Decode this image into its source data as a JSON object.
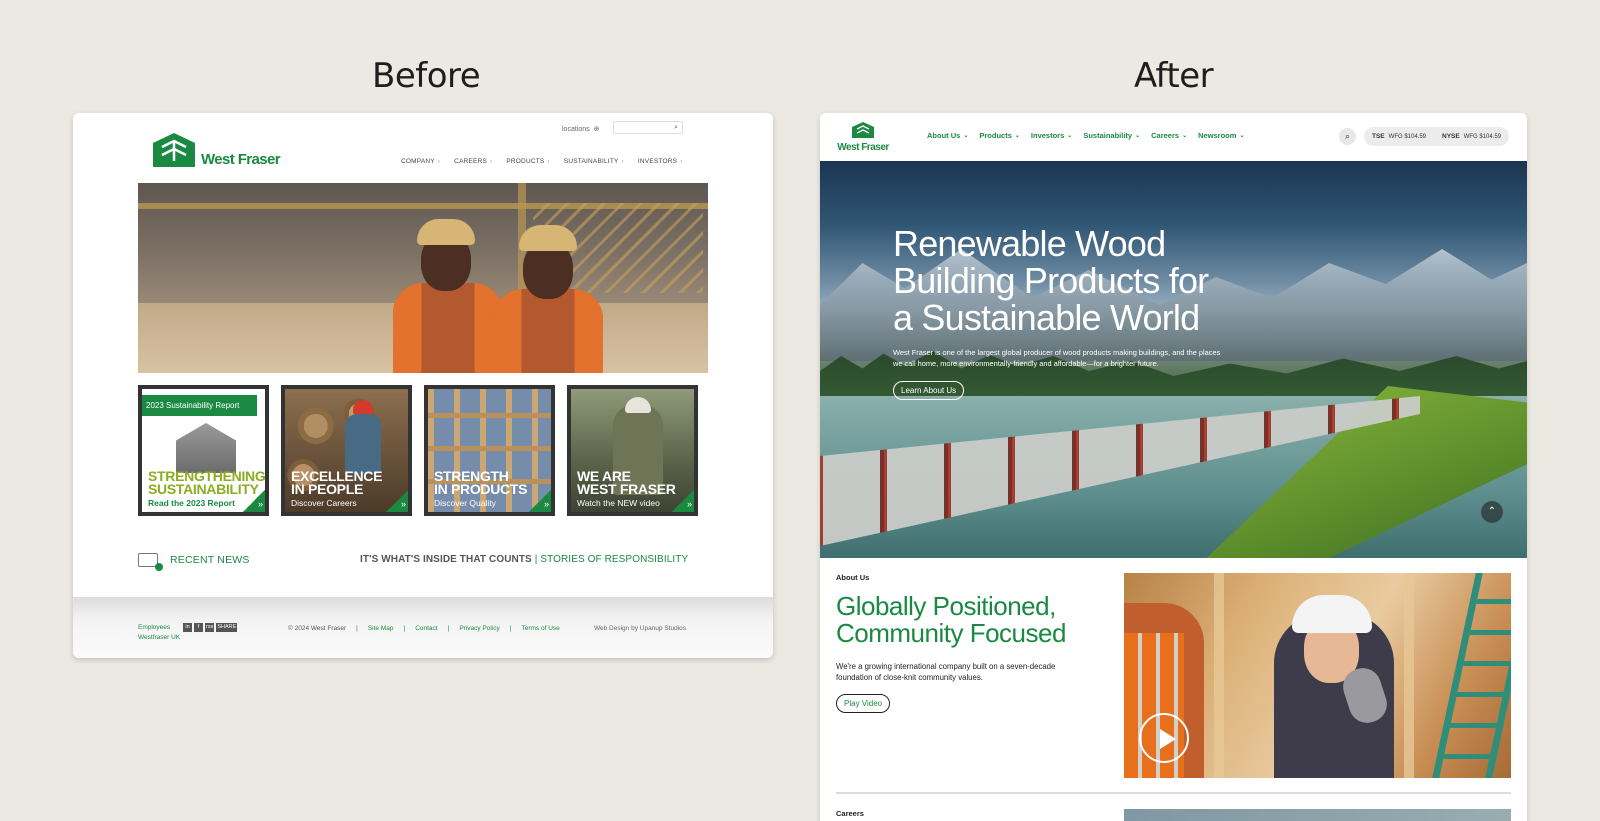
{
  "headings": {
    "before": "Before",
    "after": "After"
  },
  "before": {
    "logo_text": "West Fraser",
    "locations_label": "locations",
    "nav": [
      "COMPANY",
      "CAREERS",
      "PRODUCTS",
      "SUSTAINABILITY",
      "INVESTORS"
    ],
    "tiles": [
      {
        "badge": "2023 Sustainability Report",
        "title_line1": "STRENGTHENING",
        "title_line2": "SUSTAINABILITY",
        "sub": "Read the 2023 Report"
      },
      {
        "title_line1": "EXCELLENCE",
        "title_line2": "IN PEOPLE",
        "sub": "Discover Careers"
      },
      {
        "title_line1": "STRENGTH",
        "title_line2": "IN PRODUCTS",
        "sub": "Discover Quality"
      },
      {
        "title_line1": "WE ARE",
        "title_line2": "WEST FRASER",
        "sub": "Watch the NEW video"
      }
    ],
    "recent_news": "RECENT NEWS",
    "tagline_left": "IT'S WHAT'S INSIDE THAT COUNTS",
    "tagline_sep": "|",
    "tagline_right": "STORIES OF RESPONSIBILITY",
    "footer": {
      "employees": "Employees",
      "westfraser_uk": "Westfraser UK",
      "social": [
        "in",
        "f",
        "rss",
        "SHARE"
      ],
      "copyright": "© 2024 West Fraser",
      "links": [
        "Site Map",
        "Contact",
        "Privacy Policy",
        "Terms of Use"
      ],
      "credit": "Web Design by Upanup Studios"
    }
  },
  "after": {
    "logo_text": "West Fraser",
    "nav": [
      "About Us",
      "Products",
      "Investors",
      "Sustainability",
      "Careers",
      "Newsroom"
    ],
    "ticker": {
      "tse_label": "TSE",
      "tse_value": "WFG $104.59",
      "nyse_label": "NYSE",
      "nyse_value": "WFG $104.59"
    },
    "hero": {
      "title": "Renewable Wood Building Products for a Sustainable World",
      "subtitle": "West Fraser is one of the largest global producer of wood products making buildings, and the places we call home, more environmentally-friendly and affordable—for a brighter future.",
      "button": "Learn About Us"
    },
    "about": {
      "label": "About Us",
      "title": "Globally Positioned, Community Focused",
      "text": "We're a growing international company built on a seven-decade foundation of close-knit community values.",
      "button": "Play Video"
    },
    "careers_label": "Careers"
  },
  "colors": {
    "brand_green": "#1a8a43",
    "background": "#ece9e3"
  },
  "icons": {
    "search": "search-icon",
    "locations": "globe-icon",
    "scroll_up": "chevron-up-icon",
    "play": "play-icon"
  }
}
